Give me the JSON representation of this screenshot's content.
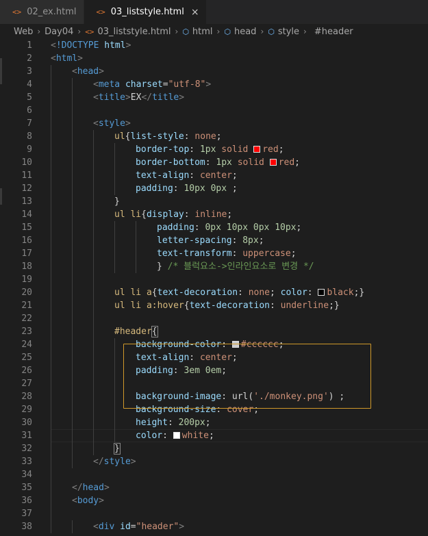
{
  "tabs": [
    {
      "icon": "<>",
      "label": "02_ex.html",
      "active": false
    },
    {
      "icon": "<>",
      "label": "03_liststyle.html",
      "active": true,
      "close": "×"
    }
  ],
  "breadcrumb": [
    "Web",
    "Day04",
    "03_liststyle.html",
    "html",
    "head",
    "style",
    "#header"
  ],
  "colors": {
    "red": "#ff0000",
    "black": "#000000",
    "cccccc": "#cccccc",
    "white": "#ffffff",
    "selection_border": "#d19a2a"
  },
  "editor": {
    "lines": [
      {
        "n": "1",
        "indent": 0,
        "tokens": [
          [
            "c-punct",
            "<"
          ],
          [
            "c-tag",
            "!DOCTYPE "
          ],
          [
            "c-attr",
            "html"
          ],
          [
            "c-punct",
            ">"
          ]
        ]
      },
      {
        "n": "2",
        "indent": 0,
        "tokens": [
          [
            "c-punct",
            "<"
          ],
          [
            "c-tag",
            "html"
          ],
          [
            "c-punct",
            ">"
          ]
        ]
      },
      {
        "n": "3",
        "indent": 1,
        "tokens": [
          [
            "c-punct",
            "<"
          ],
          [
            "c-tag",
            "head"
          ],
          [
            "c-punct",
            ">"
          ]
        ]
      },
      {
        "n": "4",
        "indent": 2,
        "tokens": [
          [
            "c-punct",
            "<"
          ],
          [
            "c-tag",
            "meta "
          ],
          [
            "c-attr",
            "charset"
          ],
          [
            "c-text",
            "="
          ],
          [
            "c-str",
            "\"utf-8\""
          ],
          [
            "c-punct",
            ">"
          ]
        ]
      },
      {
        "n": "5",
        "indent": 2,
        "tokens": [
          [
            "c-punct",
            "<"
          ],
          [
            "c-tag",
            "title"
          ],
          [
            "c-punct",
            ">"
          ],
          [
            "c-text",
            "EX"
          ],
          [
            "c-punct",
            "</"
          ],
          [
            "c-tag",
            "title"
          ],
          [
            "c-punct",
            ">"
          ]
        ]
      },
      {
        "n": "6",
        "indent": 0,
        "tokens": []
      },
      {
        "n": "7",
        "indent": 2,
        "tokens": [
          [
            "c-punct",
            "<"
          ],
          [
            "c-tag",
            "style"
          ],
          [
            "c-punct",
            ">"
          ]
        ]
      },
      {
        "n": "8",
        "indent": 3,
        "tokens": [
          [
            "c-sel",
            "ul"
          ],
          [
            "c-text",
            "{"
          ],
          [
            "c-prop",
            "list-style"
          ],
          [
            "c-text",
            ": "
          ],
          [
            "c-val",
            "none"
          ],
          [
            "c-text",
            ";"
          ]
        ]
      },
      {
        "n": "9",
        "indent": 4,
        "tokens": [
          [
            "c-prop",
            "border-top"
          ],
          [
            "c-text",
            ": "
          ],
          [
            "c-num",
            "1px "
          ],
          [
            "c-val",
            "solid "
          ],
          [
            "swatch",
            "red"
          ],
          [
            "c-val",
            "red"
          ],
          [
            "c-text",
            ";"
          ]
        ]
      },
      {
        "n": "10",
        "indent": 4,
        "tokens": [
          [
            "c-prop",
            "border-bottom"
          ],
          [
            "c-text",
            ": "
          ],
          [
            "c-num",
            "1px "
          ],
          [
            "c-val",
            "solid "
          ],
          [
            "swatch",
            "red"
          ],
          [
            "c-val",
            "red"
          ],
          [
            "c-text",
            ";"
          ]
        ]
      },
      {
        "n": "11",
        "indent": 4,
        "tokens": [
          [
            "c-prop",
            "text-align"
          ],
          [
            "c-text",
            ": "
          ],
          [
            "c-val",
            "center"
          ],
          [
            "c-text",
            ";"
          ]
        ]
      },
      {
        "n": "12",
        "indent": 4,
        "tokens": [
          [
            "c-prop",
            "padding"
          ],
          [
            "c-text",
            ": "
          ],
          [
            "c-num",
            "10px 0px "
          ],
          [
            "c-text",
            ";"
          ]
        ]
      },
      {
        "n": "13",
        "indent": 3,
        "tokens": [
          [
            "c-text",
            "}"
          ]
        ]
      },
      {
        "n": "14",
        "indent": 3,
        "tokens": [
          [
            "c-sel",
            "ul li"
          ],
          [
            "c-text",
            "{"
          ],
          [
            "c-prop",
            "display"
          ],
          [
            "c-text",
            ": "
          ],
          [
            "c-val",
            "inline"
          ],
          [
            "c-text",
            ";"
          ]
        ]
      },
      {
        "n": "15",
        "indent": 5,
        "tokens": [
          [
            "c-prop",
            "padding"
          ],
          [
            "c-text",
            ": "
          ],
          [
            "c-num",
            "0px 10px 0px 10px"
          ],
          [
            "c-text",
            ";"
          ]
        ]
      },
      {
        "n": "16",
        "indent": 5,
        "tokens": [
          [
            "c-prop",
            "letter-spacing"
          ],
          [
            "c-text",
            ": "
          ],
          [
            "c-num",
            "8px"
          ],
          [
            "c-text",
            ";"
          ]
        ]
      },
      {
        "n": "17",
        "indent": 5,
        "tokens": [
          [
            "c-prop",
            "text-transform"
          ],
          [
            "c-text",
            ": "
          ],
          [
            "c-val",
            "uppercase"
          ],
          [
            "c-text",
            ";"
          ]
        ]
      },
      {
        "n": "18",
        "indent": 5,
        "tokens": [
          [
            "c-text",
            "} "
          ],
          [
            "c-comment",
            "/* 블럭요소->인라인요소로 변경 */"
          ]
        ]
      },
      {
        "n": "19",
        "indent": 0,
        "tokens": []
      },
      {
        "n": "20",
        "indent": 3,
        "tokens": [
          [
            "c-sel",
            "ul li a"
          ],
          [
            "c-text",
            "{"
          ],
          [
            "c-prop",
            "text-decoration"
          ],
          [
            "c-text",
            ": "
          ],
          [
            "c-val",
            "none"
          ],
          [
            "c-text",
            "; "
          ],
          [
            "c-prop",
            "color"
          ],
          [
            "c-text",
            ": "
          ],
          [
            "swatch",
            "black"
          ],
          [
            "c-val",
            "black"
          ],
          [
            "c-text",
            ";}"
          ]
        ]
      },
      {
        "n": "21",
        "indent": 3,
        "tokens": [
          [
            "c-sel",
            "ul li a:hover"
          ],
          [
            "c-text",
            "{"
          ],
          [
            "c-prop",
            "text-decoration"
          ],
          [
            "c-text",
            ": "
          ],
          [
            "c-val",
            "underline"
          ],
          [
            "c-text",
            ";}"
          ]
        ]
      },
      {
        "n": "22",
        "indent": 0,
        "tokens": []
      },
      {
        "n": "23",
        "indent": 3,
        "tokens": [
          [
            "c-sel",
            "#header"
          ],
          [
            "bracket",
            "{"
          ]
        ]
      },
      {
        "n": "24",
        "indent": 4,
        "tokens": [
          [
            "c-prop",
            "background-color"
          ],
          [
            "c-text",
            ": "
          ],
          [
            "swatch",
            "cccccc"
          ],
          [
            "c-val",
            "#cccccc"
          ],
          [
            "c-text",
            ";"
          ]
        ]
      },
      {
        "n": "25",
        "indent": 4,
        "tokens": [
          [
            "c-prop",
            "text-align"
          ],
          [
            "c-text",
            ": "
          ],
          [
            "c-val",
            "center"
          ],
          [
            "c-text",
            ";"
          ]
        ]
      },
      {
        "n": "26",
        "indent": 4,
        "tokens": [
          [
            "c-prop",
            "padding"
          ],
          [
            "c-text",
            ": "
          ],
          [
            "c-num",
            "3em 0em"
          ],
          [
            "c-text",
            ";"
          ]
        ]
      },
      {
        "n": "27",
        "indent": 0,
        "tokens": []
      },
      {
        "n": "28",
        "indent": 4,
        "tokens": [
          [
            "c-prop",
            "background-image"
          ],
          [
            "c-text",
            ": "
          ],
          [
            "c-text",
            "url("
          ],
          [
            "c-str",
            "'./monkey.png'"
          ],
          [
            "c-text",
            ") ;"
          ]
        ]
      },
      {
        "n": "29",
        "indent": 4,
        "tokens": [
          [
            "c-prop",
            "background-size"
          ],
          [
            "c-text",
            ": "
          ],
          [
            "c-val",
            "cover"
          ],
          [
            "c-text",
            ";"
          ]
        ]
      },
      {
        "n": "30",
        "indent": 4,
        "tokens": [
          [
            "c-prop",
            "height"
          ],
          [
            "c-text",
            ": "
          ],
          [
            "c-num",
            "200px"
          ],
          [
            "c-text",
            ";"
          ]
        ]
      },
      {
        "n": "31",
        "indent": 4,
        "tokens": [
          [
            "c-prop",
            "color"
          ],
          [
            "c-text",
            ": "
          ],
          [
            "swatch",
            "white"
          ],
          [
            "c-val",
            "white"
          ],
          [
            "c-text",
            ";"
          ]
        ]
      },
      {
        "n": "32",
        "indent": 3,
        "tokens": [
          [
            "bracket",
            "}"
          ]
        ]
      },
      {
        "n": "33",
        "indent": 2,
        "tokens": [
          [
            "c-punct",
            "</"
          ],
          [
            "c-tag",
            "style"
          ],
          [
            "c-punct",
            ">"
          ]
        ]
      },
      {
        "n": "34",
        "indent": 0,
        "tokens": []
      },
      {
        "n": "35",
        "indent": 1,
        "tokens": [
          [
            "c-punct",
            "</"
          ],
          [
            "c-tag",
            "head"
          ],
          [
            "c-punct",
            ">"
          ]
        ]
      },
      {
        "n": "36",
        "indent": 1,
        "tokens": [
          [
            "c-punct",
            "<"
          ],
          [
            "c-tag",
            "body"
          ],
          [
            "c-punct",
            ">"
          ]
        ]
      },
      {
        "n": "37",
        "indent": 0,
        "tokens": []
      },
      {
        "n": "38",
        "indent": 2,
        "tokens": [
          [
            "c-punct",
            "<"
          ],
          [
            "c-tag",
            "div "
          ],
          [
            "c-attr",
            "id"
          ],
          [
            "c-text",
            "="
          ],
          [
            "c-str",
            "\"header\""
          ],
          [
            "c-punct",
            ">"
          ]
        ]
      }
    ]
  }
}
